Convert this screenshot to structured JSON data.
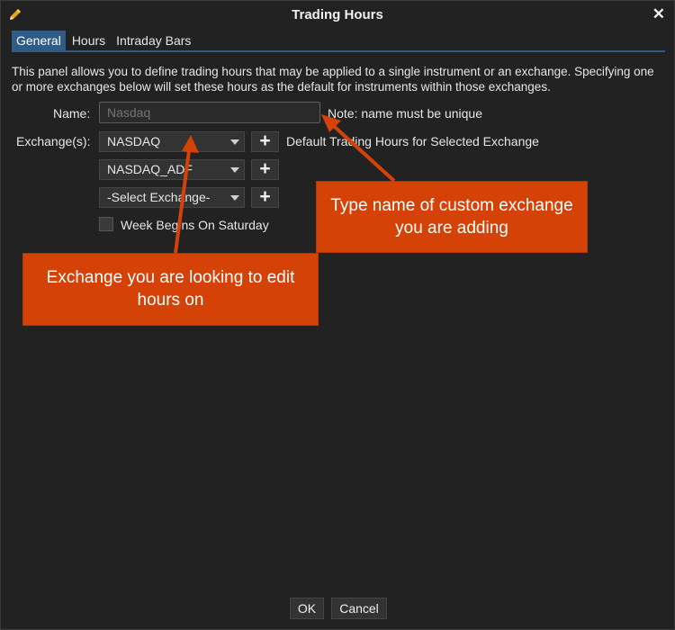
{
  "window": {
    "title": "Trading Hours",
    "title_icon": "pencil-icon",
    "close_label": "✕"
  },
  "tabs": [
    {
      "label": "General",
      "active": true
    },
    {
      "label": "Hours",
      "active": false
    },
    {
      "label": "Intraday Bars",
      "active": false
    }
  ],
  "description": "This panel allows you to define trading hours that may be applied to a single instrument or an exchange. Specifying one or more exchanges below will set these hours as the default for instruments within those exchanges.",
  "form": {
    "name_label": "Name:",
    "name_placeholder": "Nasdaq",
    "name_note": "Note: name must be unique",
    "exchanges_label": "Exchange(s):",
    "exchanges": [
      {
        "value": "NASDAQ"
      },
      {
        "value": "NASDAQ_ADF"
      },
      {
        "value": "-Select Exchange-"
      }
    ],
    "add_label": "+",
    "default_hours_label": "Default Trading Hours for Selected Exchange",
    "week_saturday_label": "Week Begins On Saturday"
  },
  "callouts": {
    "name_hint": "Type name of custom exchange you are adding",
    "exchange_hint": "Exchange you are looking to edit hours on"
  },
  "buttons": {
    "ok": "OK",
    "cancel": "Cancel"
  },
  "colors": {
    "accent": "#2e5c86",
    "callout": "#d44208",
    "background": "#222222"
  }
}
